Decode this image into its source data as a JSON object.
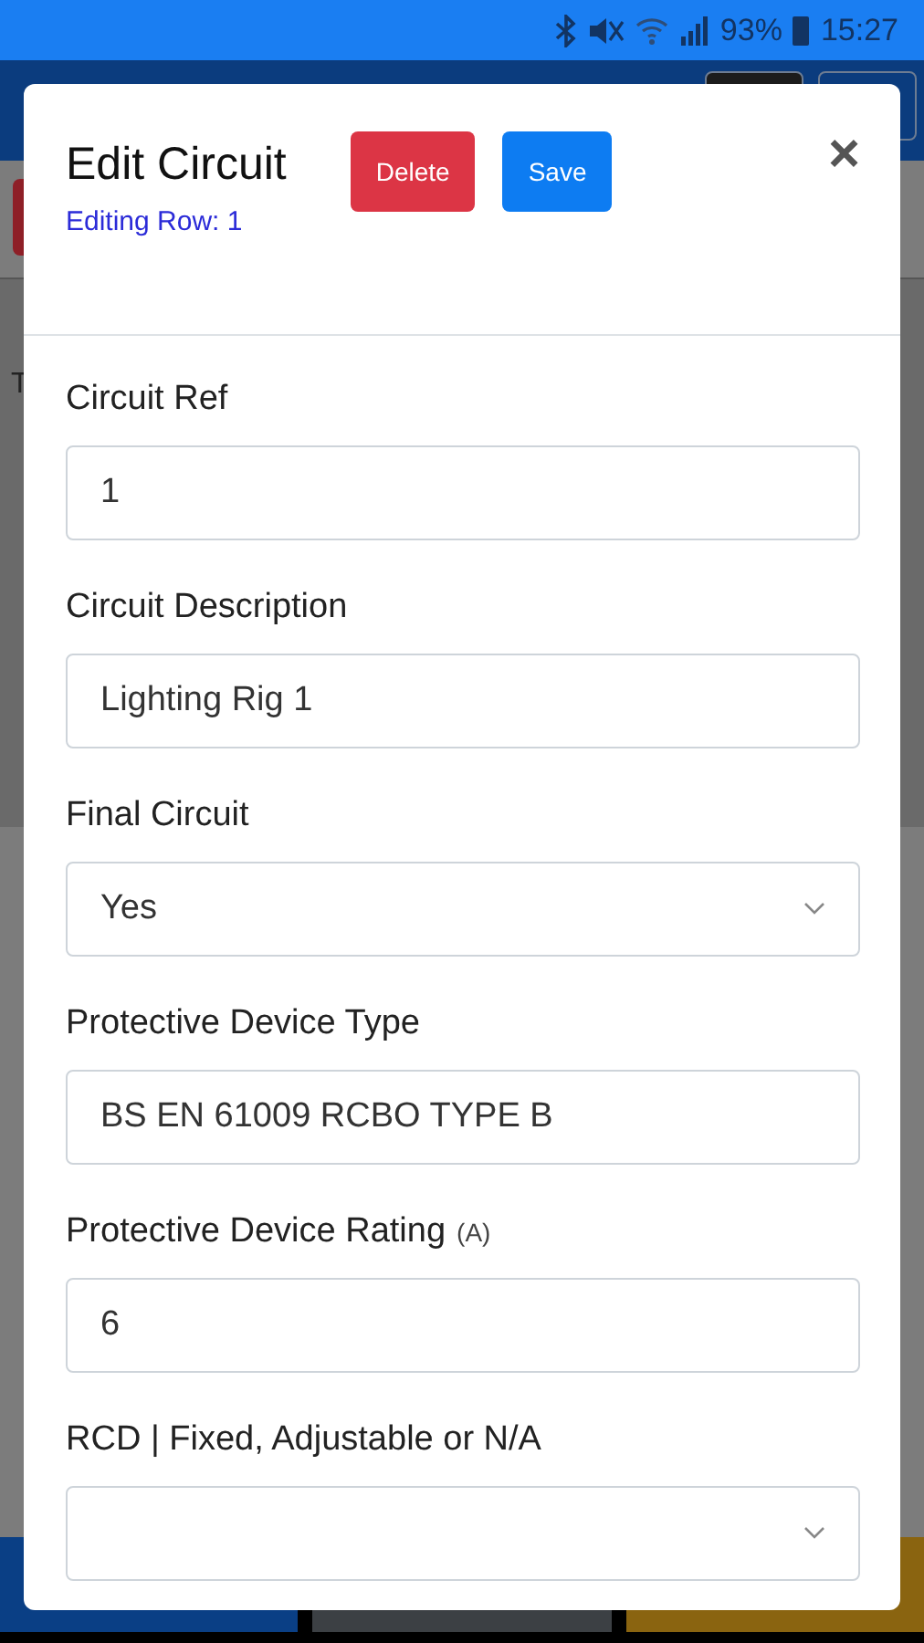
{
  "status_bar": {
    "battery": "93%",
    "time": "15:27"
  },
  "background": {
    "letter": "T"
  },
  "modal": {
    "title": "Edit Circuit",
    "subtitle": "Editing Row: 1",
    "buttons": [
      {
        "label": "Delete",
        "kind": "danger"
      },
      {
        "label": "Save",
        "kind": "primary"
      }
    ],
    "close": "×",
    "fields": [
      {
        "label": "Circuit Ref",
        "kind": "text",
        "value": "1"
      },
      {
        "label": "Circuit Description",
        "kind": "text",
        "value": "Lighting Rig 1"
      },
      {
        "label": "Final Circuit",
        "kind": "select",
        "value": "Yes"
      },
      {
        "label": "Protective Device Type",
        "kind": "text",
        "value": "BS EN 61009 RCBO TYPE B"
      },
      {
        "label": "Protective Device Rating",
        "unit": "(A)",
        "kind": "text",
        "value": "6"
      },
      {
        "label": "RCD | Fixed, Adjustable or N/A",
        "kind": "select"
      }
    ]
  }
}
